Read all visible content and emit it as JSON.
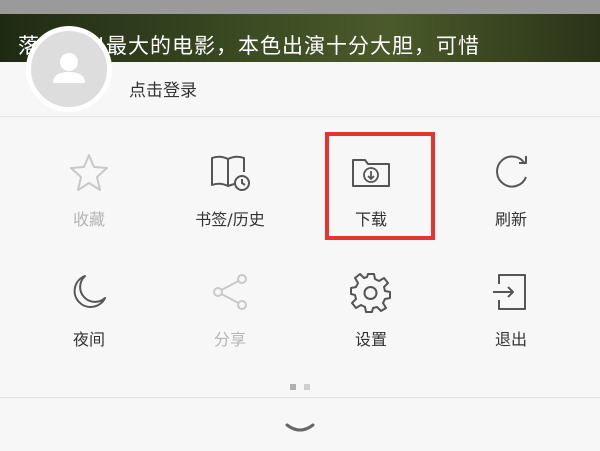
{
  "background": {
    "headline": "落…付出最大的电影，本色出演十分大胆，可惜"
  },
  "login": {
    "label": "点击登录"
  },
  "menu": {
    "items": [
      {
        "name": "favorites",
        "label": "收藏",
        "icon": "star-icon",
        "enabled": false
      },
      {
        "name": "bookmarks-history",
        "label": "书签/历史",
        "icon": "book-clock-icon",
        "enabled": true
      },
      {
        "name": "download",
        "label": "下载",
        "icon": "folder-download-icon",
        "enabled": true,
        "highlighted": true
      },
      {
        "name": "refresh",
        "label": "刷新",
        "icon": "refresh-icon",
        "enabled": true
      },
      {
        "name": "night",
        "label": "夜间",
        "icon": "moon-icon",
        "enabled": true
      },
      {
        "name": "share",
        "label": "分享",
        "icon": "share-icon",
        "enabled": false
      },
      {
        "name": "settings",
        "label": "设置",
        "icon": "gear-icon",
        "enabled": true
      },
      {
        "name": "exit",
        "label": "退出",
        "icon": "exit-icon",
        "enabled": true
      }
    ]
  },
  "pager": {
    "pages": 2,
    "current": 1
  },
  "colors": {
    "highlight": "#e8342c",
    "icon": "#555555",
    "icon_disabled": "#c8c8c8"
  }
}
